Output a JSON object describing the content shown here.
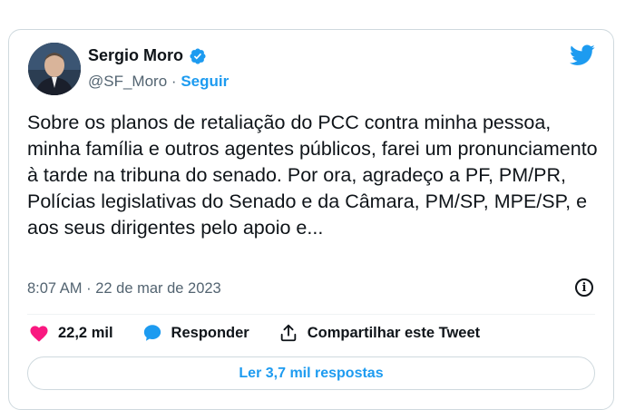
{
  "author": {
    "name": "Sergio Moro",
    "handle": "@SF_Moro",
    "separator": "·",
    "follow_label": "Seguir"
  },
  "tweet": {
    "text": "Sobre os planos de retaliação do PCC contra minha pessoa, minha família e outros agentes públicos, farei um pronunciamento à tarde na tribuna do senado. Por ora, agradeço a PF, PM/PR, Polícias legislativas do Senado e da Câmara, PM/SP, MPE/SP, e aos seus dirigentes pelo apoio e...",
    "timestamp": "8:07 AM · 22 de mar de 2023"
  },
  "actions": {
    "likes": "22,2 mil",
    "reply_label": "Responder",
    "share_label": "Compartilhar este Tweet"
  },
  "replies_button": "Ler 3,7 mil respostas",
  "icons": {
    "like": "heart-icon",
    "reply": "speech-bubble-icon",
    "share": "share-arrow-icon",
    "info": "info-icon",
    "brand": "twitter-bird-icon",
    "verified": "verified-badge-icon"
  },
  "colors": {
    "accent": "#1d9bf0",
    "like": "#f91880",
    "text": "#0f1419",
    "secondary": "#536471"
  }
}
